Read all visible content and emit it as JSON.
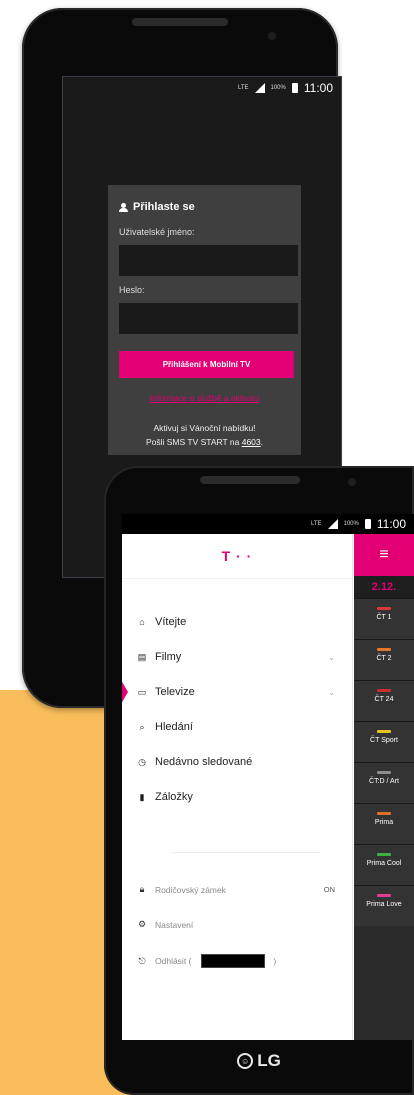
{
  "phone1": {
    "status": {
      "net": "LTE",
      "battery": "100%",
      "time": "11:00"
    },
    "login": {
      "title": "Přihlaste se",
      "username_label": "Uživatelské jméno:",
      "username_value": "",
      "password_label": "Heslo:",
      "password_value": "",
      "login_button": "Přihlášení k Mobilní TV",
      "info_link": "Informace o službě a aktivaci",
      "promo_line1": "Aktivuj si Vánoční nabídku!",
      "promo_line2_prefix": "Pošli SMS TV START na ",
      "promo_number": "4603",
      "promo_suffix": "."
    }
  },
  "phone2": {
    "status": {
      "net": "LTE",
      "battery": "100%",
      "time": "11:00"
    },
    "logo": "T · ·",
    "menu": [
      {
        "label": "Vítejte",
        "icon": "home-icon"
      },
      {
        "label": "Filmy",
        "icon": "film-icon",
        "chevron": "⌄"
      },
      {
        "label": "Televize",
        "icon": "tv-icon",
        "chevron": "⌄",
        "active": true
      },
      {
        "label": "Hledání",
        "icon": "search-icon"
      },
      {
        "label": "Nedávno sledované",
        "icon": "history-icon"
      },
      {
        "label": "Záložky",
        "icon": "bookmark-icon"
      }
    ],
    "submenu": [
      {
        "label": "Rodičovský zámek",
        "icon": "lock-icon",
        "value": "ON"
      },
      {
        "label": "Nastavení",
        "icon": "settings-icon"
      },
      {
        "label": "Odhlásit (",
        "icon": "logout-icon",
        "suffix": ")"
      }
    ],
    "date": "2.12.",
    "channels": [
      {
        "name": "ČT 1",
        "color": "#d83a3a"
      },
      {
        "name": "ČT 2",
        "color": "#e07a2a"
      },
      {
        "name": "ČT 24",
        "color": "#c43030"
      },
      {
        "name": "ČT Sport",
        "color": "#e8c21f"
      },
      {
        "name": "ČT:D / Art",
        "color": "#8c8c8c"
      },
      {
        "name": "Prima",
        "color": "#e0712a"
      },
      {
        "name": "Prima Cool",
        "color": "#3fae3f"
      },
      {
        "name": "Prima Love",
        "color": "#e23d8f"
      }
    ],
    "brand": "LG"
  }
}
